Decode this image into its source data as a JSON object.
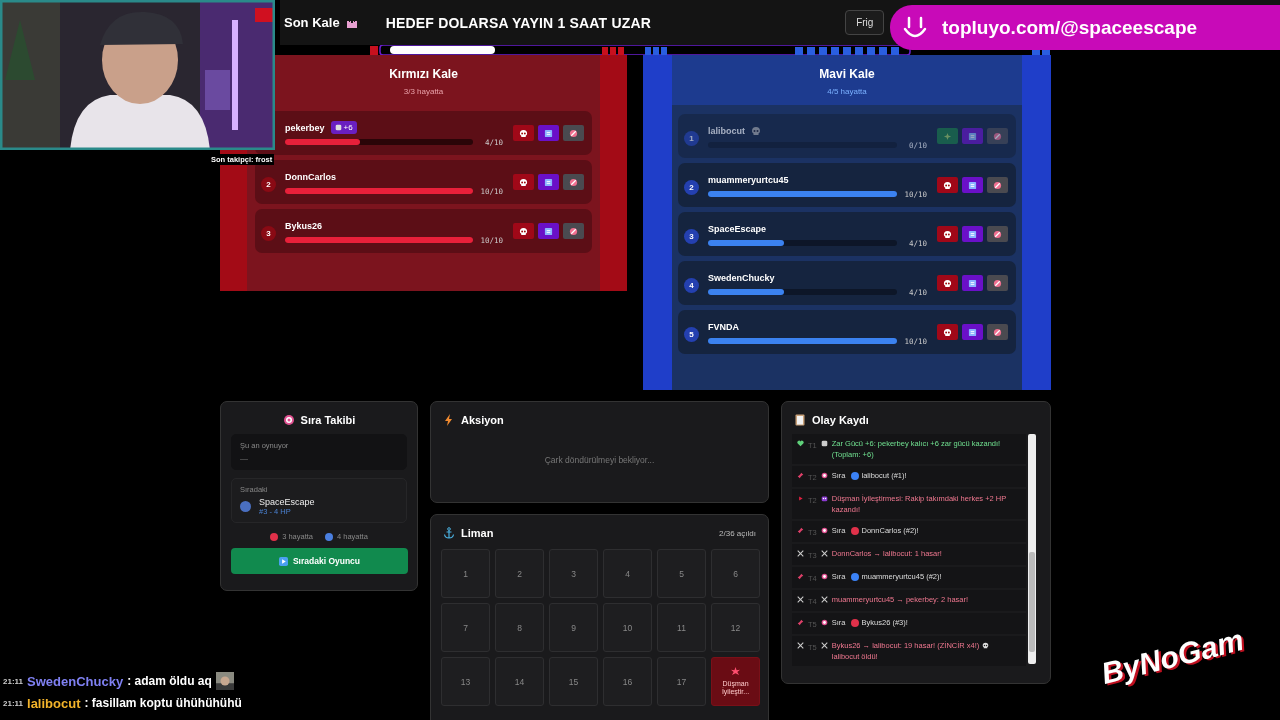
{
  "overlay": {
    "follower": "Son takipçi: frost",
    "banner": "topluyo.com/@spaceescape",
    "logo": "ByNoGam",
    "chat": [
      {
        "time": "21:11",
        "user": "SwedenChucky",
        "color": "#7f80f2",
        "message": ": adam öldu aq"
      },
      {
        "time": "21:11",
        "user": "lalibocut",
        "color": "#f2b32a",
        "message": ": fasillam koptu ühühühühü"
      }
    ]
  },
  "header": {
    "title": "Son Kale",
    "goal": "HEDEF DOLARSA YAYIN 1 SAAT UZAR",
    "button": "Frig"
  },
  "teams": [
    {
      "kind": "red",
      "name": "Kırmızı Kale",
      "alive": "3/3 hayatta",
      "players": [
        {
          "name": "pekerbey",
          "badge": "+6",
          "level": 0.4,
          "hp": "4/10",
          "dead": false
        },
        {
          "rank": "2",
          "name": "DonnCarlos",
          "level": 1,
          "hp": "10/10",
          "dead": false
        },
        {
          "rank": "3",
          "name": "Bykus26",
          "level": 1,
          "hp": "10/10",
          "dead": false
        }
      ]
    },
    {
      "kind": "blue",
      "name": "Mavi Kale",
      "alive": "4/5 hayatta",
      "players": [
        {
          "rank": "1",
          "name": "lalibocut",
          "level": 0,
          "hp": "0/10",
          "dead": true
        },
        {
          "rank": "2",
          "name": "muammeryurtcu45",
          "level": 1,
          "hp": "10/10",
          "dead": false
        },
        {
          "rank": "3",
          "name": "SpaceEscape",
          "level": 0.4,
          "hp": "4/10",
          "dead": false
        },
        {
          "rank": "4",
          "name": "SwedenChucky",
          "level": 0.4,
          "hp": "4/10",
          "dead": false
        },
        {
          "rank": "5",
          "name": "FVNDA",
          "level": 1,
          "hp": "10/10",
          "dead": false
        }
      ]
    }
  ],
  "turn_tracker": {
    "title": "Sıra Takibi",
    "current_label": "Şu an oynuyor",
    "current": "—",
    "next": {
      "label": "Sıradaki",
      "name": "SpaceEscape",
      "color": "#4a6fc0",
      "detail": "#3 - 4 HP"
    },
    "counts": [
      {
        "color": "#e0314a",
        "text": "3 hayatta"
      },
      {
        "color": "#4a7fe0",
        "text": "4 hayatta"
      }
    ],
    "button": "Sıradaki Oyuncu"
  },
  "action": {
    "title": "Aksiyon",
    "status": "Çark döndürülmeyi bekliyor..."
  },
  "harbor": {
    "title": "Liman",
    "opened": "2/36 açıldı",
    "tiles": [
      {
        "kind": "number",
        "label": "1"
      },
      {
        "kind": "number",
        "label": "2"
      },
      {
        "kind": "number",
        "label": "3"
      },
      {
        "kind": "number",
        "label": "4"
      },
      {
        "kind": "number",
        "label": "5"
      },
      {
        "kind": "number",
        "label": "6"
      },
      {
        "kind": "number",
        "label": "7"
      },
      {
        "kind": "number",
        "label": "8"
      },
      {
        "kind": "number",
        "label": "9"
      },
      {
        "kind": "number",
        "label": "10"
      },
      {
        "kind": "number",
        "label": "11"
      },
      {
        "kind": "number",
        "label": "12"
      },
      {
        "kind": "number",
        "label": "13"
      },
      {
        "kind": "number",
        "label": "14"
      },
      {
        "kind": "number",
        "label": "15"
      },
      {
        "kind": "number",
        "label": "16"
      },
      {
        "kind": "number",
        "label": "17"
      },
      {
        "kind": "revealed",
        "label": "Düşman İyileştir..."
      }
    ]
  },
  "log": {
    "title": "Olay Kaydı",
    "entries": [
      {
        "kind": "power",
        "turn": "T1",
        "text": "Zar Gücü +6: pekerbey kalıcı +6 zar gücü kazandı! (Toplam: +6)"
      },
      {
        "kind": "turn",
        "turn": "T2",
        "prefix": "Sıra",
        "color": "#3b82f6",
        "text": "lalibocut (#1)!"
      },
      {
        "kind": "event",
        "turn": "T2",
        "text": "Düşman İyileştirmesi: Rakip takımdaki herkes +2 HP kazandı!"
      },
      {
        "kind": "turn",
        "turn": "T3",
        "prefix": "Sıra",
        "color": "#e0314a",
        "text": "DonnCarlos (#2)!"
      },
      {
        "kind": "attack",
        "turn": "T3",
        "text": "DonnCarlos → lalibocut: 1 hasar!"
      },
      {
        "kind": "turn",
        "turn": "T4",
        "prefix": "Sıra",
        "color": "#3b82f6",
        "text": "muammeryurtcu45 (#2)!"
      },
      {
        "kind": "attack",
        "turn": "T4",
        "text": "muammeryurtcu45 → pekerbey: 2 hasar!"
      },
      {
        "kind": "turn",
        "turn": "T5",
        "prefix": "Sıra",
        "color": "#e0314a",
        "text": "Bykus26 (#3)!"
      },
      {
        "kind": "attack",
        "turn": "T5",
        "text": "Bykus26 → lalibocut: 19 hasar! (ZİNCİR x4!)",
        "after": "lalibocut öldü!"
      }
    ]
  }
}
